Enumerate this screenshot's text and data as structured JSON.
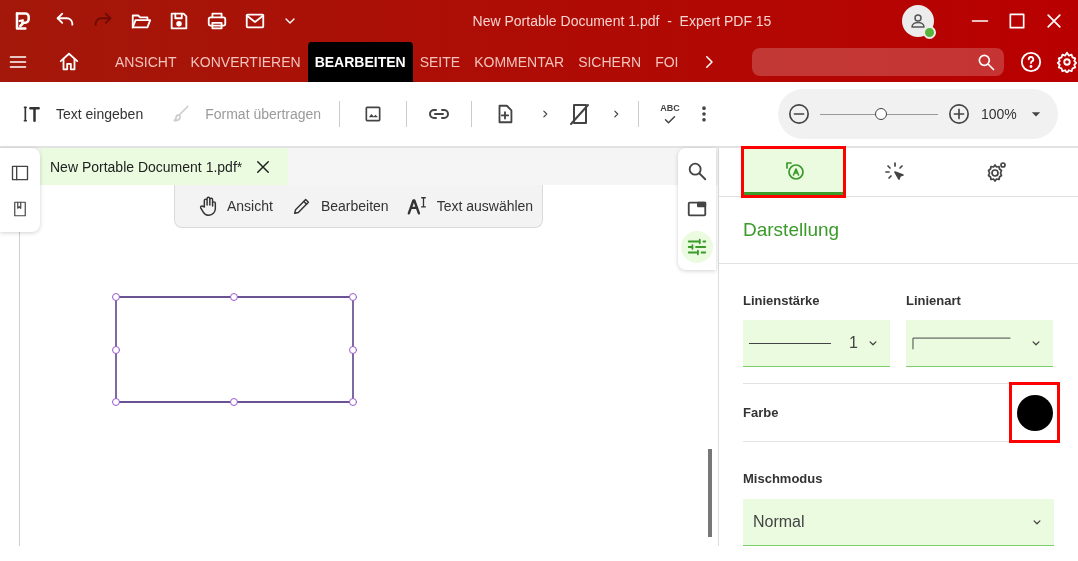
{
  "title_bar": {
    "title": "New Portable Document 1.pdf  -  Expert PDF 15",
    "quick_access": [
      {
        "kind": "undo",
        "disabled": false
      },
      {
        "kind": "redo",
        "disabled": true
      },
      {
        "kind": "open",
        "disabled": false
      },
      {
        "kind": "save",
        "disabled": false
      },
      {
        "kind": "print",
        "disabled": false
      },
      {
        "kind": "mail",
        "disabled": false
      },
      {
        "kind": "more",
        "disabled": false
      }
    ]
  },
  "ribbon": {
    "tabs": [
      {
        "label": "ANSICHT",
        "selected": false
      },
      {
        "label": "KONVERTIEREN",
        "selected": false
      },
      {
        "label": "BEARBEITEN",
        "selected": true
      },
      {
        "label": "SEITE",
        "selected": false
      },
      {
        "label": "KOMMENTAR",
        "selected": false
      },
      {
        "label": "SICHERN",
        "selected": false
      },
      {
        "label": "FOI",
        "selected": false
      }
    ]
  },
  "toolbar": {
    "tools": [
      {
        "kind": "text",
        "label": "Text eingeben",
        "disabled": false
      },
      {
        "kind": "format",
        "label": "Format übertragen",
        "disabled": true
      }
    ],
    "spellcheck_label": "ABC",
    "zoom": {
      "level": 0.52,
      "reading": "100%"
    }
  },
  "document_tab": {
    "label": "New Portable Document 1.pdf*"
  },
  "mode_bar": [
    {
      "kind": "hand",
      "label": "Ansicht"
    },
    {
      "kind": "pencil",
      "label": "Bearbeiten"
    },
    {
      "kind": "select",
      "label": "Text auswählen"
    }
  ],
  "side_tools": [
    {
      "kind": "search",
      "selected": false
    },
    {
      "kind": "window",
      "selected": false
    },
    {
      "kind": "sliders",
      "selected": true
    }
  ],
  "panel": {
    "tabs": [
      {
        "kind": "appearance",
        "selected": true,
        "highlighted": true
      },
      {
        "kind": "action",
        "selected": false,
        "highlighted": false
      },
      {
        "kind": "settings",
        "selected": false,
        "highlighted": false
      }
    ],
    "heading": "Darstellung",
    "line_width": {
      "label": "Linienstärke",
      "value": "1"
    },
    "line_style": {
      "label": "Linienart"
    },
    "color": {
      "label": "Farbe",
      "color": "#000000",
      "highlighted": true
    },
    "blend_mode": {
      "label": "Mischmodus",
      "value": "Normal"
    }
  }
}
